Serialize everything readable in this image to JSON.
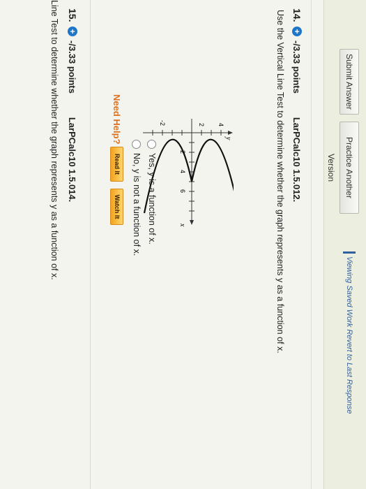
{
  "toolbar": {
    "submit_label": "Submit Answer",
    "practice_label": "Practice Another Version",
    "viewing_text": "Viewing Saved Work Revert to Last Response"
  },
  "question14": {
    "number": "14.",
    "points": "-/3.33 points",
    "source": "LarPCalc10 1.5.012.",
    "prompt": "Use the Vertical Line Test to determine whether the graph represents y as a function of x.",
    "options": [
      "Yes, y is a function of x.",
      "No, y is not a function of x."
    ],
    "need_help": "Need Help?",
    "read_label": "Read It",
    "watch_label": "Watch It"
  },
  "graph": {
    "axis_x": "x",
    "axis_y": "y",
    "ticks_x": [
      "2",
      "4",
      "6"
    ],
    "ticks_y": [
      "4",
      "2",
      "-2"
    ]
  },
  "question15": {
    "number": "15.",
    "points": "-/3.33 points",
    "source": "LarPCalc10 1.5.014.",
    "prompt": "Line Test to determine whether the graph represents y as a function of x."
  },
  "colors": {
    "accent": "#1f76c8",
    "help": "#e0701a",
    "button": "#f2a320"
  }
}
